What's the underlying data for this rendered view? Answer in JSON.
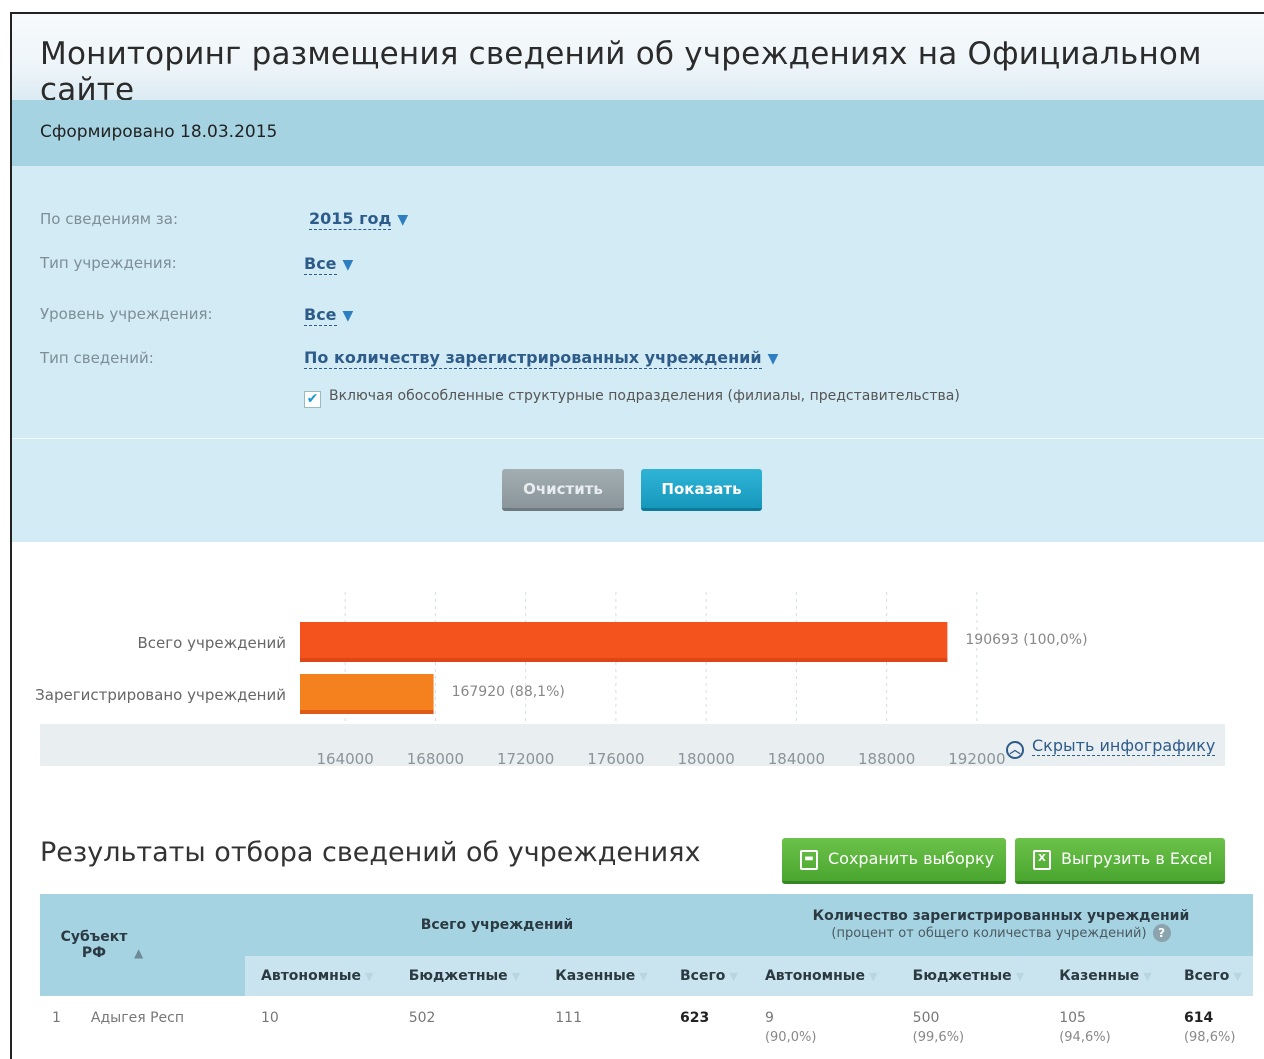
{
  "header": {
    "title": "Мониторинг размещения сведений об учреждениях на Официальном сайте"
  },
  "formed": {
    "text": "Сформировано 18.03.2015"
  },
  "filters": [
    {
      "label": "По сведениям за:",
      "value": "2015 год"
    },
    {
      "label": "Тип учреждения:",
      "value": "Все"
    },
    {
      "label": "Уровень учреждения:",
      "value": "Все"
    },
    {
      "label": "Тип сведений:",
      "value": "По количеству зарегистрированных учреждений"
    }
  ],
  "checkbox": {
    "label": "Включая обособленные структурные подразделения (филиалы, представительства)",
    "checked": true
  },
  "buttons": {
    "clear": "Очистить",
    "show": "Показать"
  },
  "chart_data": {
    "type": "bar",
    "orientation": "horizontal",
    "categories": [
      "Всего учреждений",
      "Зарегистрировано учреждений"
    ],
    "values": [
      190693,
      167920
    ],
    "data_labels": [
      "190693 (100,0%)",
      "167920 (88,1%)"
    ],
    "colors": [
      "#f5531e",
      "#f5801e"
    ],
    "xlim": [
      162000,
      194000
    ],
    "x_ticks": [
      164000,
      168000,
      172000,
      176000,
      180000,
      184000,
      188000,
      192000
    ],
    "grid": true
  },
  "hide_infographic": "Скрыть инфографику",
  "results": {
    "title": "Результаты отбора сведений об учреждениях",
    "save_label": "Сохранить выборку",
    "excel_label": "Выгрузить в Excel",
    "col_subject": "Субъект РФ",
    "group_total": "Всего учреждений",
    "group_reg": "Количество зарегистрированных учреждений",
    "group_reg_note": "(процент от общего количества учреждений)",
    "subcols": [
      "Автономные",
      "Бюджетные",
      "Казенные",
      "Всего",
      "Автономные",
      "Бюджетные",
      "Казенные",
      "Всего"
    ],
    "rows": [
      {
        "num": "1",
        "name": "Адыгея Респ",
        "a": "10",
        "b": "502",
        "k": "111",
        "t": "623",
        "ra": "9",
        "ra_p": "(90,0%)",
        "rb": "500",
        "rb_p": "(99,6%)",
        "rk": "105",
        "rk_p": "(94,6%)",
        "rt": "614",
        "rt_p": "(98,6%)"
      }
    ]
  }
}
